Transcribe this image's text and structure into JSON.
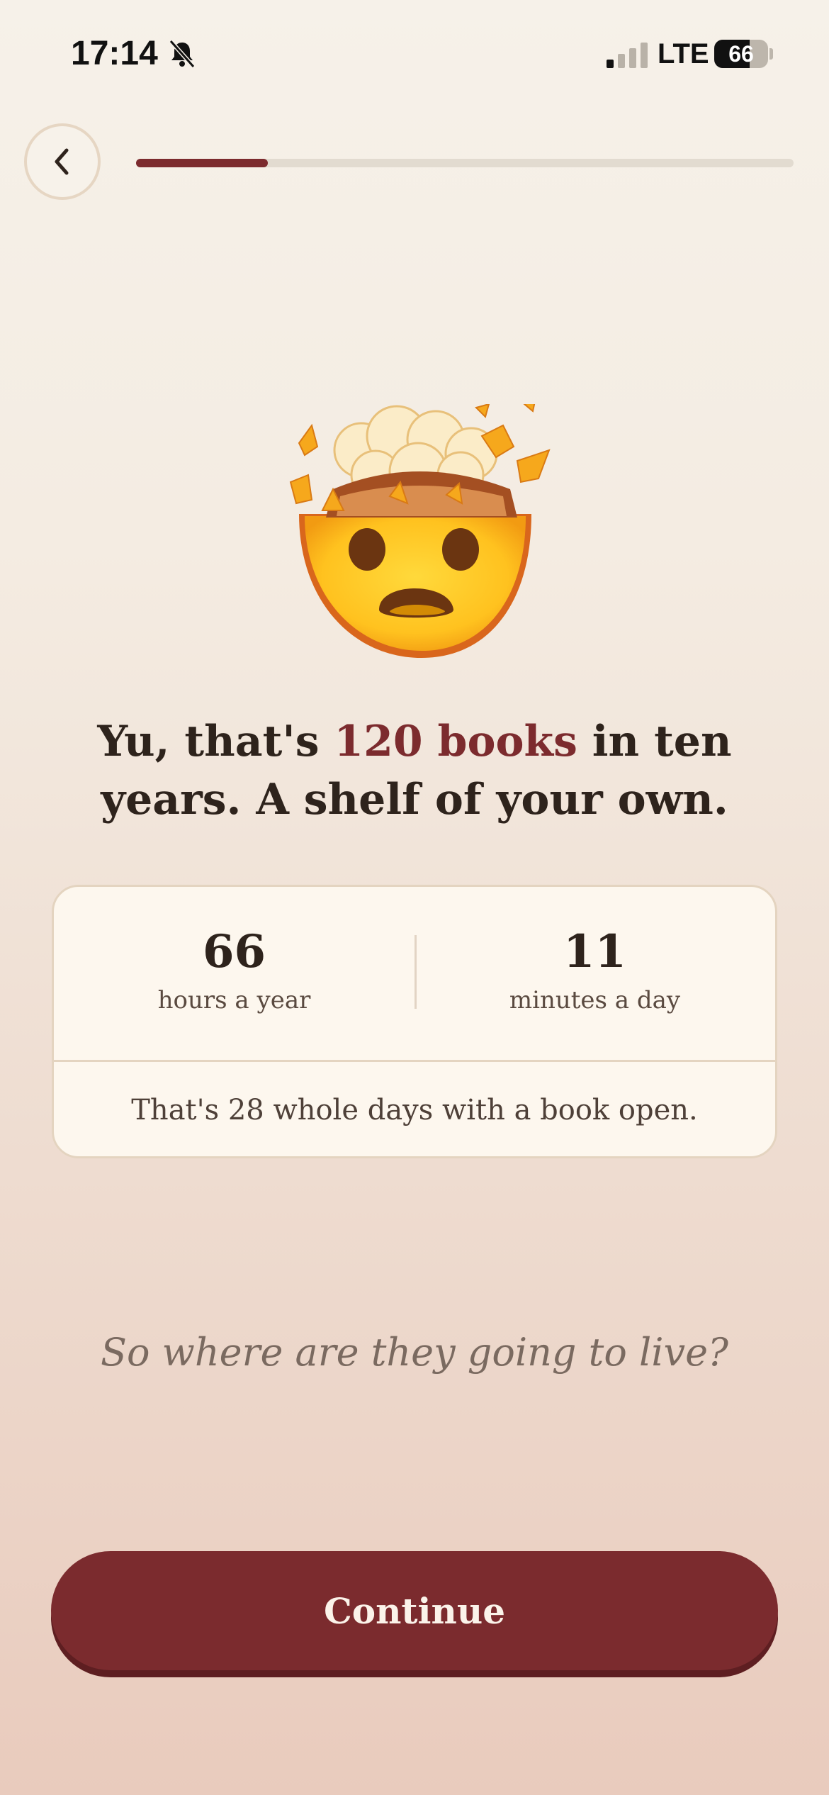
{
  "status_bar": {
    "time": "17:14",
    "network": "LTE",
    "battery_level": "66",
    "battery_fraction": 0.66,
    "signal_bars_active": 1,
    "signal_bars_total": 4
  },
  "header": {
    "back_icon": "chevron-left-icon",
    "progress_fraction": 0.2
  },
  "hero": {
    "emoji": "exploding-head-emoji"
  },
  "headline": {
    "before": "Yu, that's ",
    "highlight": "120 books",
    "after": " in ten years. A shelf of your own."
  },
  "stats": {
    "left": {
      "value": "66",
      "label": "hours a year"
    },
    "right": {
      "value": "11",
      "label": "minutes a day"
    },
    "footer": "That's 28 whole days with a book open."
  },
  "question": "So where are they going to live?",
  "continue_label": "Continue",
  "colors": {
    "accent": "#7b2b2e",
    "text_dark": "#2e231c",
    "card_bg": "#fdf7ee"
  }
}
